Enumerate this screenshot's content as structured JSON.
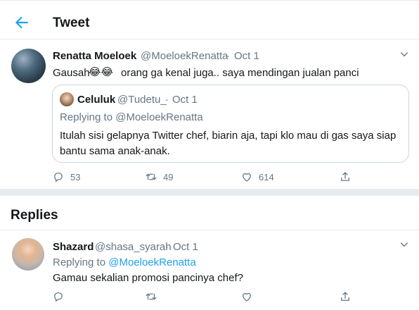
{
  "header": {
    "title": "Tweet"
  },
  "tweet": {
    "display_name": "Renatta Moeloek",
    "handle": "@MoeloekRenatta",
    "separator": "·",
    "date": "Oct 1",
    "text_before": "Gausah",
    "emojis": "😂😂",
    "text_after": "orang ga kenal juga.. saya mendingan jualan panci",
    "quote": {
      "display_name": "Celuluk",
      "handle": "@Tudetu_",
      "separator": "·",
      "date": "Oct 1",
      "replying_prefix": "Replying to",
      "replying_handle": "@MoeloekRenatta",
      "line1": "Itulah sisi gelapnya Twitter chef, biarin aja, tapi klo mau di gas saya siap",
      "line2": "bantu sama anak-anak."
    },
    "actions": {
      "replies": "53",
      "retweets": "49",
      "likes": "614"
    }
  },
  "replies_section": {
    "title": "Replies"
  },
  "reply": {
    "display_name": "Shazard",
    "handle": "@shasa_syarah",
    "separator": "·",
    "date": "Oct 1",
    "replying_prefix": "Replying to",
    "replying_handle": "@MoeloekRenatta",
    "text": "Gamau sekalian promosi pancinya chef?"
  },
  "colors": {
    "accent": "#1da1f2",
    "secondary_text": "#657786",
    "border": "#e6ecf0"
  }
}
